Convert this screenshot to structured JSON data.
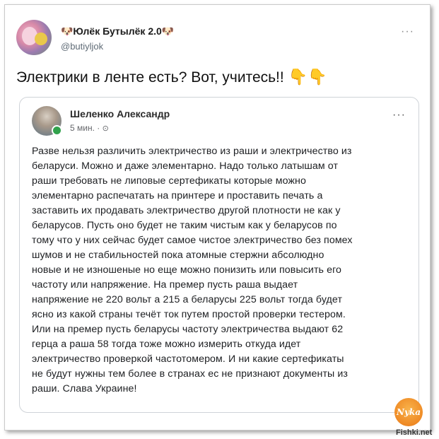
{
  "tweet": {
    "author_name": "🐶Юлёк Бутылёк 2.0🐶",
    "handle": "@butiyljok",
    "text": "Электрики в ленте есть? Вот, учитесь!!",
    "emoji": "👇👇"
  },
  "facebook_post": {
    "author_name": "Шеленко Александр",
    "time": "5 мин. ·",
    "globe_glyph": "⊙",
    "lines": [
      "Разве нельзя различить электричество из раши и электричество из",
      "беларуси. Можно и даже элементарно. Надо только латышам от",
      "раши требовать не липовые сертефикаты которые можно",
      "элементарно распечатать на принтере и проставить печать а",
      "заставить их продавать электричество другой плотности не как у",
      "беларусов. Пусть оно будет не таким чистым как у беларусов по",
      "тому что у них сейчас будет самое чистое электричество без помех",
      "шумов и не стабильностей пока атомные стержни абсолюдно",
      "новые и не изношеные но еще можно понизить или повысить его",
      "частоту или напряжение. На премер пусть раша выдает",
      "напряжение не 220 вольт а 215 а беларусы 225 вольт тогда будет",
      "ясно из какой страны течёт ток путем простой проверки тестером.",
      "Или на премер пусть беларусы частоту электричества выдают 62",
      "герца а раша 58 тогда тоже можно измерить откуда идет",
      "электричество проверкой частотомером. И ни какие сертефикаты",
      "не будут нужны тем более в странах ес не признают документы из",
      "раши. Слава Украине!"
    ]
  },
  "logo_text": "Nyka",
  "watermark": "Fishki.net",
  "icons": {
    "more": "···",
    "fb_more": "···"
  }
}
